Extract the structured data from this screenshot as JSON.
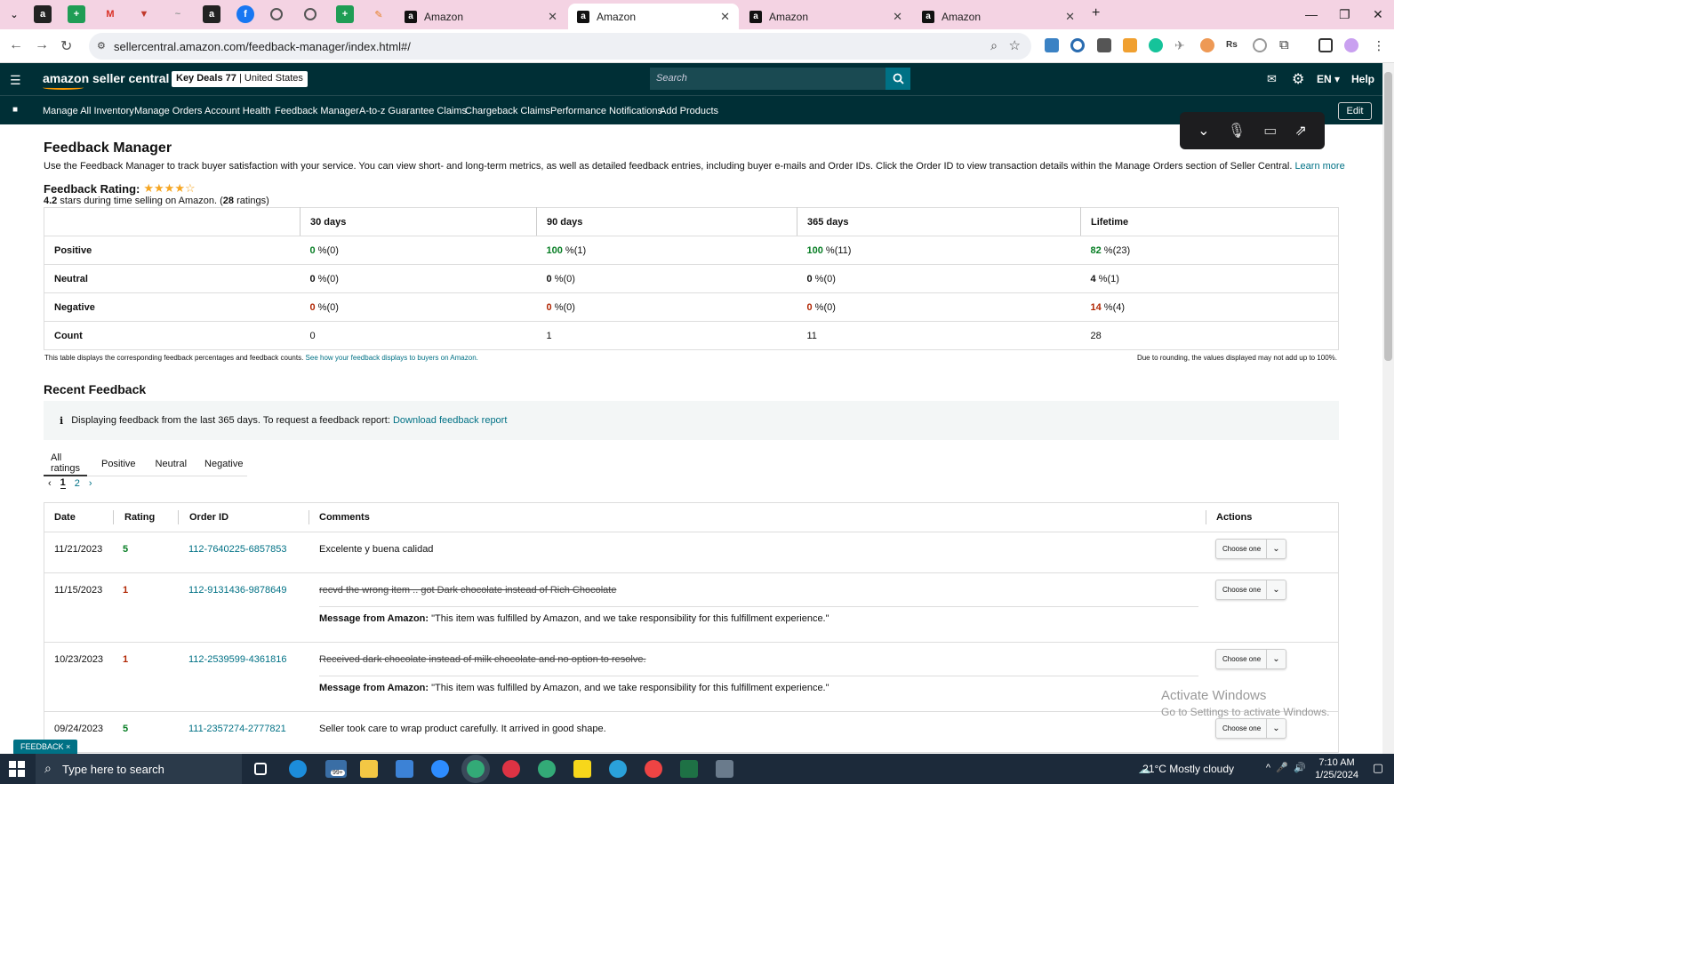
{
  "browser": {
    "tabs": [
      {
        "title": "Amazon",
        "active": false
      },
      {
        "title": "Amazon",
        "active": true
      },
      {
        "title": "Amazon",
        "active": false
      },
      {
        "title": "Amazon",
        "active": false
      }
    ],
    "url": "sellercentral.amazon.com/feedback-manager/index.html#/"
  },
  "header": {
    "logo": "amazon seller central",
    "store_name": "Key Deals 77",
    "marketplace": "United States",
    "search_placeholder": "Search",
    "lang": "EN",
    "help": "Help"
  },
  "nav": {
    "items": [
      "Manage All Inventory",
      "Manage Orders",
      "Account Health",
      "Feedback Manager",
      "A-to-z Guarantee Claims",
      "Chargeback Claims",
      "Performance Notifications",
      "Add Products"
    ],
    "edit": "Edit"
  },
  "page": {
    "title": "Feedback Manager",
    "description": "Use the Feedback Manager to track buyer satisfaction with your service. You can view short- and long-term metrics, as well as detailed feedback entries, including buyer e-mails and Order IDs. Click the Order ID to view transaction details within the Manage Orders section of Seller Central.",
    "learn_more": "Learn more",
    "rating_label": "Feedback Rating:",
    "rating_stars": 4.2,
    "rating_value": "4.2",
    "rating_text_a": " stars during time selling on Amazon. (",
    "rating_count": "28",
    "rating_text_b": " ratings)"
  },
  "summary_table": {
    "columns": [
      "30 days",
      "90 days",
      "365 days",
      "Lifetime"
    ],
    "rows": [
      {
        "label": "Positive",
        "cells": [
          {
            "v": "0",
            "t": " %(0)"
          },
          {
            "v": "100",
            "t": " %(1)"
          },
          {
            "v": "100",
            "t": " %(11)"
          },
          {
            "v": "82",
            "t": " %(23)"
          }
        ]
      },
      {
        "label": "Neutral",
        "cells": [
          {
            "v": "0",
            "t": " %(0)"
          },
          {
            "v": "0",
            "t": " %(0)"
          },
          {
            "v": "0",
            "t": " %(0)"
          },
          {
            "v": "4",
            "t": " %(1)"
          }
        ]
      },
      {
        "label": "Negative",
        "cells": [
          {
            "v": "0",
            "t": " %(0)"
          },
          {
            "v": "0",
            "t": " %(0)"
          },
          {
            "v": "0",
            "t": " %(0)"
          },
          {
            "v": "14",
            "t": " %(4)"
          }
        ]
      },
      {
        "label": "Count",
        "cells": [
          {
            "v": "0",
            "t": ""
          },
          {
            "v": "1",
            "t": ""
          },
          {
            "v": "11",
            "t": ""
          },
          {
            "v": "28",
            "t": ""
          }
        ]
      }
    ],
    "note_left": "This table displays the corresponding feedback percentages and feedback counts.",
    "note_link": "See how your feedback displays to buyers on Amazon.",
    "note_right": "Due to rounding, the values displayed may not add up to 100%."
  },
  "recent": {
    "title": "Recent Feedback",
    "info_text": "Displaying feedback from the last 365 days. To request a feedback report:",
    "info_link": "Download feedback report",
    "filter_tabs": [
      "All ratings",
      "Positive",
      "Neutral",
      "Negative"
    ],
    "pages": [
      "1",
      "2"
    ],
    "columns": [
      "Date",
      "Rating",
      "Order ID",
      "Comments",
      "Actions"
    ],
    "action_label": "Choose one",
    "message_label": "Message from Amazon:",
    "rows": [
      {
        "date": "11/21/2023",
        "rating": "5",
        "order": "112-7640225-6857853",
        "comment": "Excelente y buena calidad",
        "message": ""
      },
      {
        "date": "11/15/2023",
        "rating": "1",
        "order": "112-9131436-9878649",
        "comment": "recvd the wrong item .. got Dark chocolate instead of Rich Chocolate",
        "message": "\"This item was fulfilled by Amazon, and we take responsibility for this fulfillment experience.\""
      },
      {
        "date": "10/23/2023",
        "rating": "1",
        "order": "112-2539599-4361816",
        "comment": "Received dark chocolate instead of milk chocolate and no option to resolve.",
        "message": "\"This item was fulfilled by Amazon, and we take responsibility for this fulfillment experience.\""
      },
      {
        "date": "09/24/2023",
        "rating": "5",
        "order": "111-2357274-2777821",
        "comment": "Seller took care to wrap product carefully. It arrived in good shape.",
        "message": ""
      }
    ]
  },
  "watermark": {
    "title": "Activate Windows",
    "sub": "Go to Settings to activate Windows."
  },
  "feedback_badge": "FEEDBACK ×",
  "taskbar": {
    "search_placeholder": "Type here to search",
    "weather": "21°C  Mostly cloudy",
    "time": "7:10 AM",
    "date": "1/25/2024",
    "mail_badge": "99+"
  },
  "colors": {
    "amazon_dark": "#002f36",
    "link": "#007185",
    "positive": "#067d23",
    "negative": "#b12704",
    "tabstrip": "#f4d3e3"
  }
}
